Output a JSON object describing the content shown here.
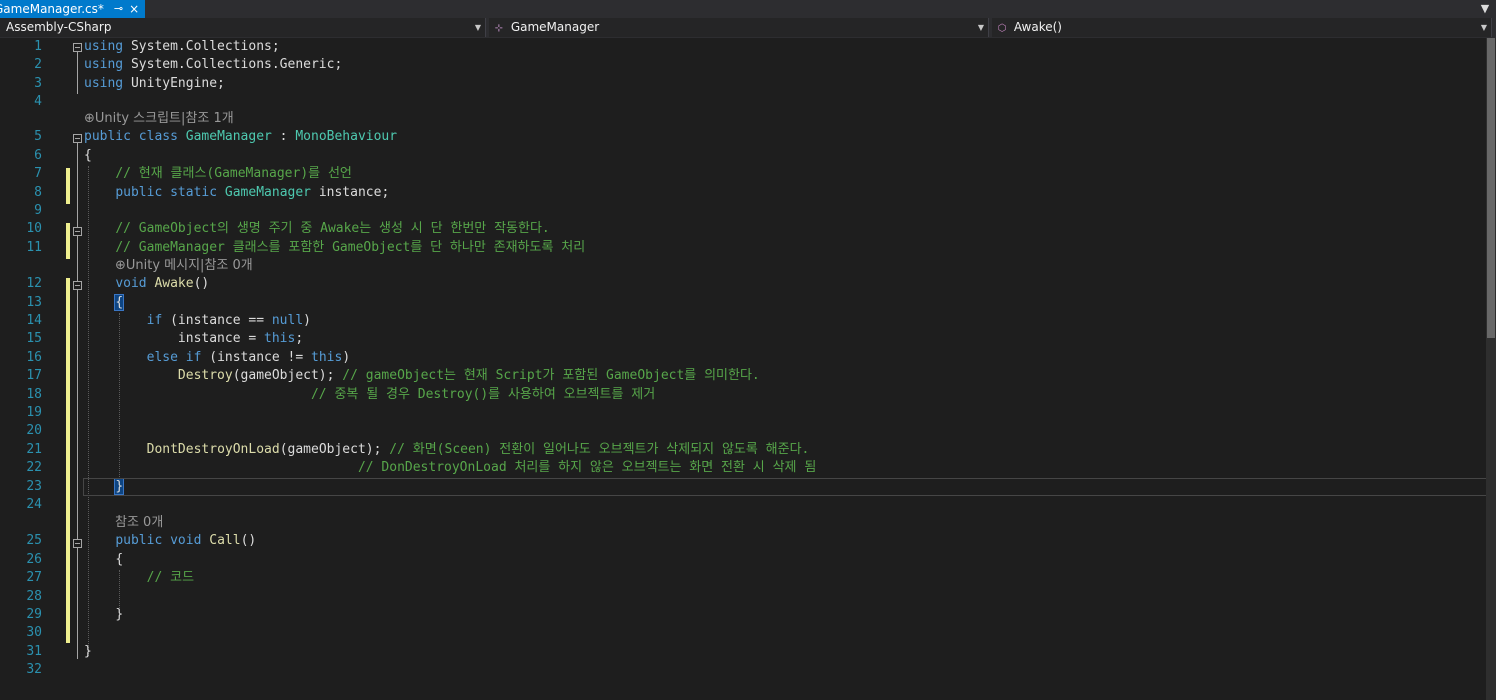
{
  "tab": {
    "title": "GameManager.cs*",
    "pin_icon": "pin-icon",
    "close_icon": "close-icon"
  },
  "navbar": {
    "project": "Assembly-CSharp",
    "type": "GameManager",
    "member": "Awake()"
  },
  "lens": {
    "class": "⊕Unity 스크립트|참조 1개",
    "awake": "⊕Unity 메시지|참조 0개",
    "call": "참조 0개"
  },
  "lines": {
    "n1": "1",
    "n2": "2",
    "n3": "3",
    "n4": "4",
    "n5": "5",
    "n6": "6",
    "n7": "7",
    "n8": "8",
    "n9": "9",
    "n10": "10",
    "n11": "11",
    "n12": "12",
    "n13": "13",
    "n14": "14",
    "n15": "15",
    "n16": "16",
    "n17": "17",
    "n18": "18",
    "n19": "19",
    "n20": "20",
    "n21": "21",
    "n22": "22",
    "n23": "23",
    "n24": "24",
    "n25": "25",
    "n26": "26",
    "n27": "27",
    "n28": "28",
    "n29": "29",
    "n30": "30",
    "n31": "31",
    "n32": "32"
  },
  "code": {
    "using": "using",
    "l1_ns": " System.Collections;",
    "l2_ns": " System.Collections.Generic;",
    "l3_ns": " UnityEngine;",
    "public": "public",
    "class": "class",
    "static": "static",
    "void": "void",
    "if": "if",
    "else": "else",
    "null": "null",
    "this": "this",
    "GameManager": "GameManager",
    "colon": " : ",
    "MonoBehaviour": "MonoBehaviour",
    "open_brace": "{",
    "close_brace": "}",
    "l7_comment": "// 현재 클래스(GameManager)를 선언",
    "l8_rest": " instance;",
    "l10_comment": "// GameObject의 생명 주기 중 Awake는 생성 시 단 한번만 작동한다.",
    "l11_comment": "// GameManager 클래스를 포함한 GameObject를 단 하나만 존재하도록 처리",
    "Awake": "Awake",
    "parens": "()",
    "l14_a": " (instance == ",
    "l14_b": ")",
    "l15_a": "instance = ",
    "l15_b": ";",
    "l16_a": " ",
    "l16_b": " (instance != ",
    "l16_c": ")",
    "Destroy": "Destroy",
    "l17_args": "(gameObject); ",
    "l17_comment": "// gameObject는 현재 Script가 포함된 GameObject를 의미한다.",
    "l18_comment": "// 중복 될 경우 Destroy()를 사용하여 오브젝트를 제거",
    "DontDestroyOnLoad": "DontDestroyOnLoad",
    "l21_args": "(gameObject); ",
    "l21_comment": "// 화면(Sceen) 전환이 일어나도 오브젝트가 삭제되지 않도록 해준다.",
    "l22_comment": "// DonDestroyOnLoad 처리를 하지 않은 오브젝트는 화면 전환 시 삭제 됨",
    "Call": "Call",
    "l27_comment": "// 코드"
  },
  "colors": {
    "keyword": "#569cd6",
    "type": "#4ec9b0",
    "comment": "#57a64a",
    "method": "#dcdcaa",
    "line_number": "#2b91af",
    "accent": "#007acc"
  }
}
